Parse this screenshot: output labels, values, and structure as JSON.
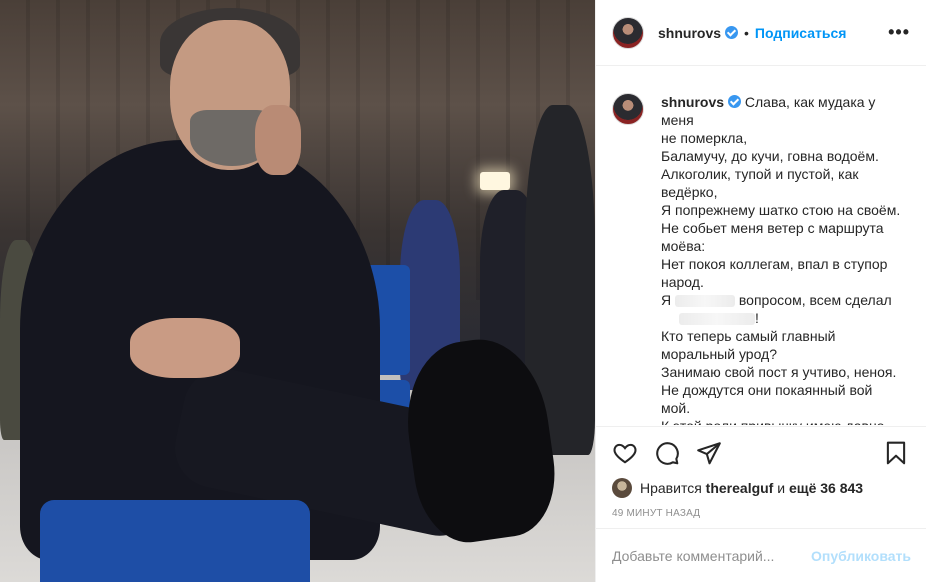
{
  "post": {
    "username": "shnurovs",
    "separator": "•",
    "follow_label": "Подписаться",
    "more_label": "•••",
    "caption_lines": [
      "Слава, как мудака у меня",
      "не померкла,",
      "Баламучу, до кучи, говна водоём.",
      "Алкоголик, тупой и пустой, как",
      "ведёрко,",
      "Я попрежнему шатко стою на своём.",
      "Не собьет меня ветер с маршрута",
      "моёва:",
      "Нет покоя коллегам, впал в ступор",
      "народ.",
      "вопросом, всем сделал",
      "Кто теперь самый главный",
      "моральный урод?",
      "Занимаю свой пост я учтиво, неноя.",
      "Не дождутся они покаянный вой",
      "мой.",
      "К этой роли привычку имею давно"
    ],
    "caption_line11_prefix": "Я",
    "caption_line11_suffix": "!",
    "likes_prefix": "Нравится",
    "likes_user": "therealguf",
    "likes_mid": "и",
    "likes_rest": "ещё 36 843",
    "time_ago": "49 минут назад",
    "comment_placeholder": "Добавьте комментарий...",
    "publish_label": "Опубликовать"
  },
  "colors": {
    "accent": "#0095f6",
    "verified": "#3897f0",
    "publish_disabled": "#b2dffc",
    "muted": "#8e8e8e"
  },
  "icons": [
    "verified-badge-icon",
    "heart-icon",
    "comment-icon",
    "share-icon",
    "bookmark-icon",
    "more-icon"
  ]
}
